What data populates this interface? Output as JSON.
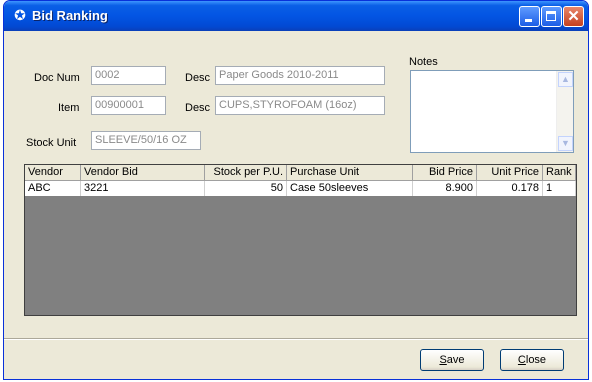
{
  "window": {
    "title": "Bid Ranking",
    "icon": "bid-ranking-icon"
  },
  "form": {
    "doc_num_label": "Doc Num",
    "doc_num_value": "0002",
    "desc1_label": "Desc",
    "desc1_value": "Paper Goods 2010-2011",
    "item_label": "Item",
    "item_value": "00900001",
    "desc2_label": "Desc",
    "desc2_value": "CUPS,STYROFOAM (16oz)",
    "stock_unit_label": "Stock Unit",
    "stock_unit_value": "SLEEVE/50/16 OZ",
    "notes_label": "Notes",
    "notes_value": ""
  },
  "grid": {
    "headers": [
      "Vendor",
      "Vendor Bid",
      "Stock per P.U.",
      "Purchase Unit",
      "Bid Price",
      "Unit Price",
      "Rank"
    ],
    "rows": [
      [
        "ABC",
        "3221",
        "50",
        "Case 50sleeves",
        "8.900",
        "0.178",
        "1"
      ]
    ]
  },
  "buttons": {
    "save_first": "S",
    "save_rest": "ave",
    "close_first": "C",
    "close_rest": "lose"
  }
}
